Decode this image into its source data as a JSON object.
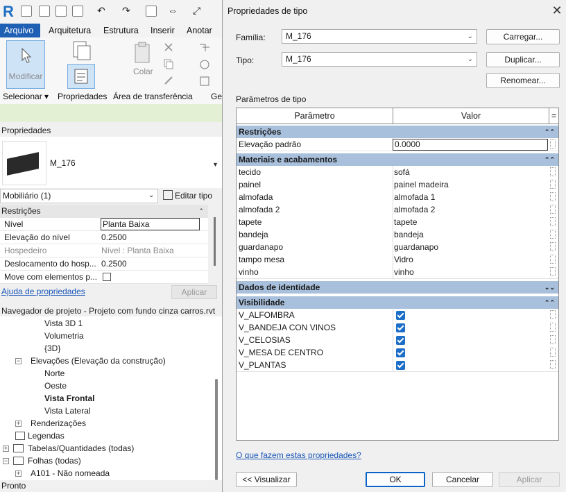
{
  "app": {
    "logo": "R",
    "menus": [
      "Arquivo",
      "Arquitetura",
      "Estrutura",
      "Inserir",
      "Anotar"
    ],
    "ribbon": {
      "modify_label": "Modificar",
      "paste_label": "Colar",
      "panels": [
        "Selecionar",
        "Propriedades",
        "Área de transferência",
        "Ge"
      ]
    }
  },
  "properties": {
    "title": "Propriedades",
    "family": "M_176",
    "category": "Mobiliário (1)",
    "edit_type": "Editar tipo",
    "section": "Restrições",
    "rows": [
      {
        "key": "Nível",
        "value": "Planta Baixa"
      },
      {
        "key": "Elevação do nível",
        "value": "0.2500"
      },
      {
        "key": "Hospedeiro",
        "value": "Nível : Planta Baixa"
      },
      {
        "key": "Deslocamento do hosp...",
        "value": "0.2500"
      },
      {
        "key": "Move com elementos p...",
        "value": ""
      }
    ],
    "help_link": "Ajuda de propriedades",
    "apply": "Aplicar"
  },
  "navigator": {
    "title": "Navegador de projeto - Projeto com fundo cinza carros.rvt",
    "items": [
      "Vista 3D 1",
      "Volumetria",
      "{3D}",
      "Elevações (Elevação da construção)",
      "Norte",
      "Oeste",
      "Vista Frontal",
      "Vista Lateral",
      "Renderizações",
      "Legendas",
      "Tabelas/Quantidades (todas)",
      "Folhas (todas)",
      "A101 - Não nomeada"
    ]
  },
  "status": {
    "text": "Pronto"
  },
  "dialog": {
    "title": "Propriedades de tipo",
    "family_label": "Família:",
    "family_value": "M_176",
    "type_label": "Tipo:",
    "type_value": "M_176",
    "load": "Carregar...",
    "duplicate": "Duplicar...",
    "rename": "Renomear...",
    "params_title": "Parâmetros de tipo",
    "col_param": "Parâmetro",
    "col_value": "Valor",
    "col_eq": "=",
    "groups": {
      "restricoes": "Restrições",
      "materiais": "Materiais e acabamentos",
      "identidade": "Dados de identidade",
      "visibilidade": "Visibilidade"
    },
    "elevation": {
      "key": "Elevação padrão",
      "value": "0.0000"
    },
    "materials": [
      {
        "key": "tecido",
        "value": "sofá"
      },
      {
        "key": "painel",
        "value": "painel madeira"
      },
      {
        "key": "almofada",
        "value": "almofada 1"
      },
      {
        "key": "almofada 2",
        "value": "almofada 2"
      },
      {
        "key": "tapete",
        "value": "tapete"
      },
      {
        "key": "bandeja",
        "value": "bandeja"
      },
      {
        "key": "guardanapo",
        "value": "guardanapo"
      },
      {
        "key": "tampo mesa",
        "value": "Vidro"
      },
      {
        "key": "vinho",
        "value": "vinho"
      }
    ],
    "visibility": [
      {
        "key": "V_ALFOMBRA",
        "checked": true
      },
      {
        "key": "V_BANDEJA CON VINOS",
        "checked": true
      },
      {
        "key": "V_CELOSIAS",
        "checked": true
      },
      {
        "key": "V_MESA DE CENTRO",
        "checked": true
      },
      {
        "key": "V_PLANTAS",
        "checked": true
      }
    ],
    "help_link": "O que fazem estas propriedades?",
    "preview": "<< Visualizar",
    "ok": "OK",
    "cancel": "Cancelar",
    "apply": "Aplicar",
    "accent": "#1d6ec9",
    "group_color": "#a8c0dc"
  }
}
